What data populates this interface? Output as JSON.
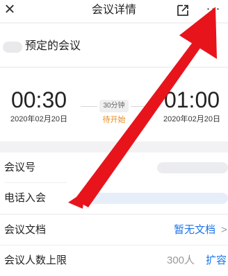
{
  "nav": {
    "close_icon": "close-icon",
    "title": "会议详情",
    "share_icon": "share-external-icon",
    "more_icon": "more-icon",
    "more_text": "···"
  },
  "organizer": {
    "suffix": "预定的会议"
  },
  "schedule": {
    "start_time": "00:30",
    "start_date": "2020年02月20日",
    "end_time": "01:00",
    "end_date": "2020年02月20日",
    "duration": "30分钟",
    "status": "待开始",
    "status_color": "#e88a1a"
  },
  "rows": {
    "meeting_id_label": "会议号",
    "phone_join_label": "电话入会",
    "docs_label": "会议文档",
    "docs_value": "暂无文档",
    "docs_chevron": ">",
    "capacity_label": "会议人数上限",
    "capacity_value": "300人",
    "expand_label": "扩容"
  },
  "annotation": {
    "arrow_color": "#e8141c"
  },
  "colors": {
    "link": "#1a73e8",
    "divider": "#f2f2f4"
  }
}
